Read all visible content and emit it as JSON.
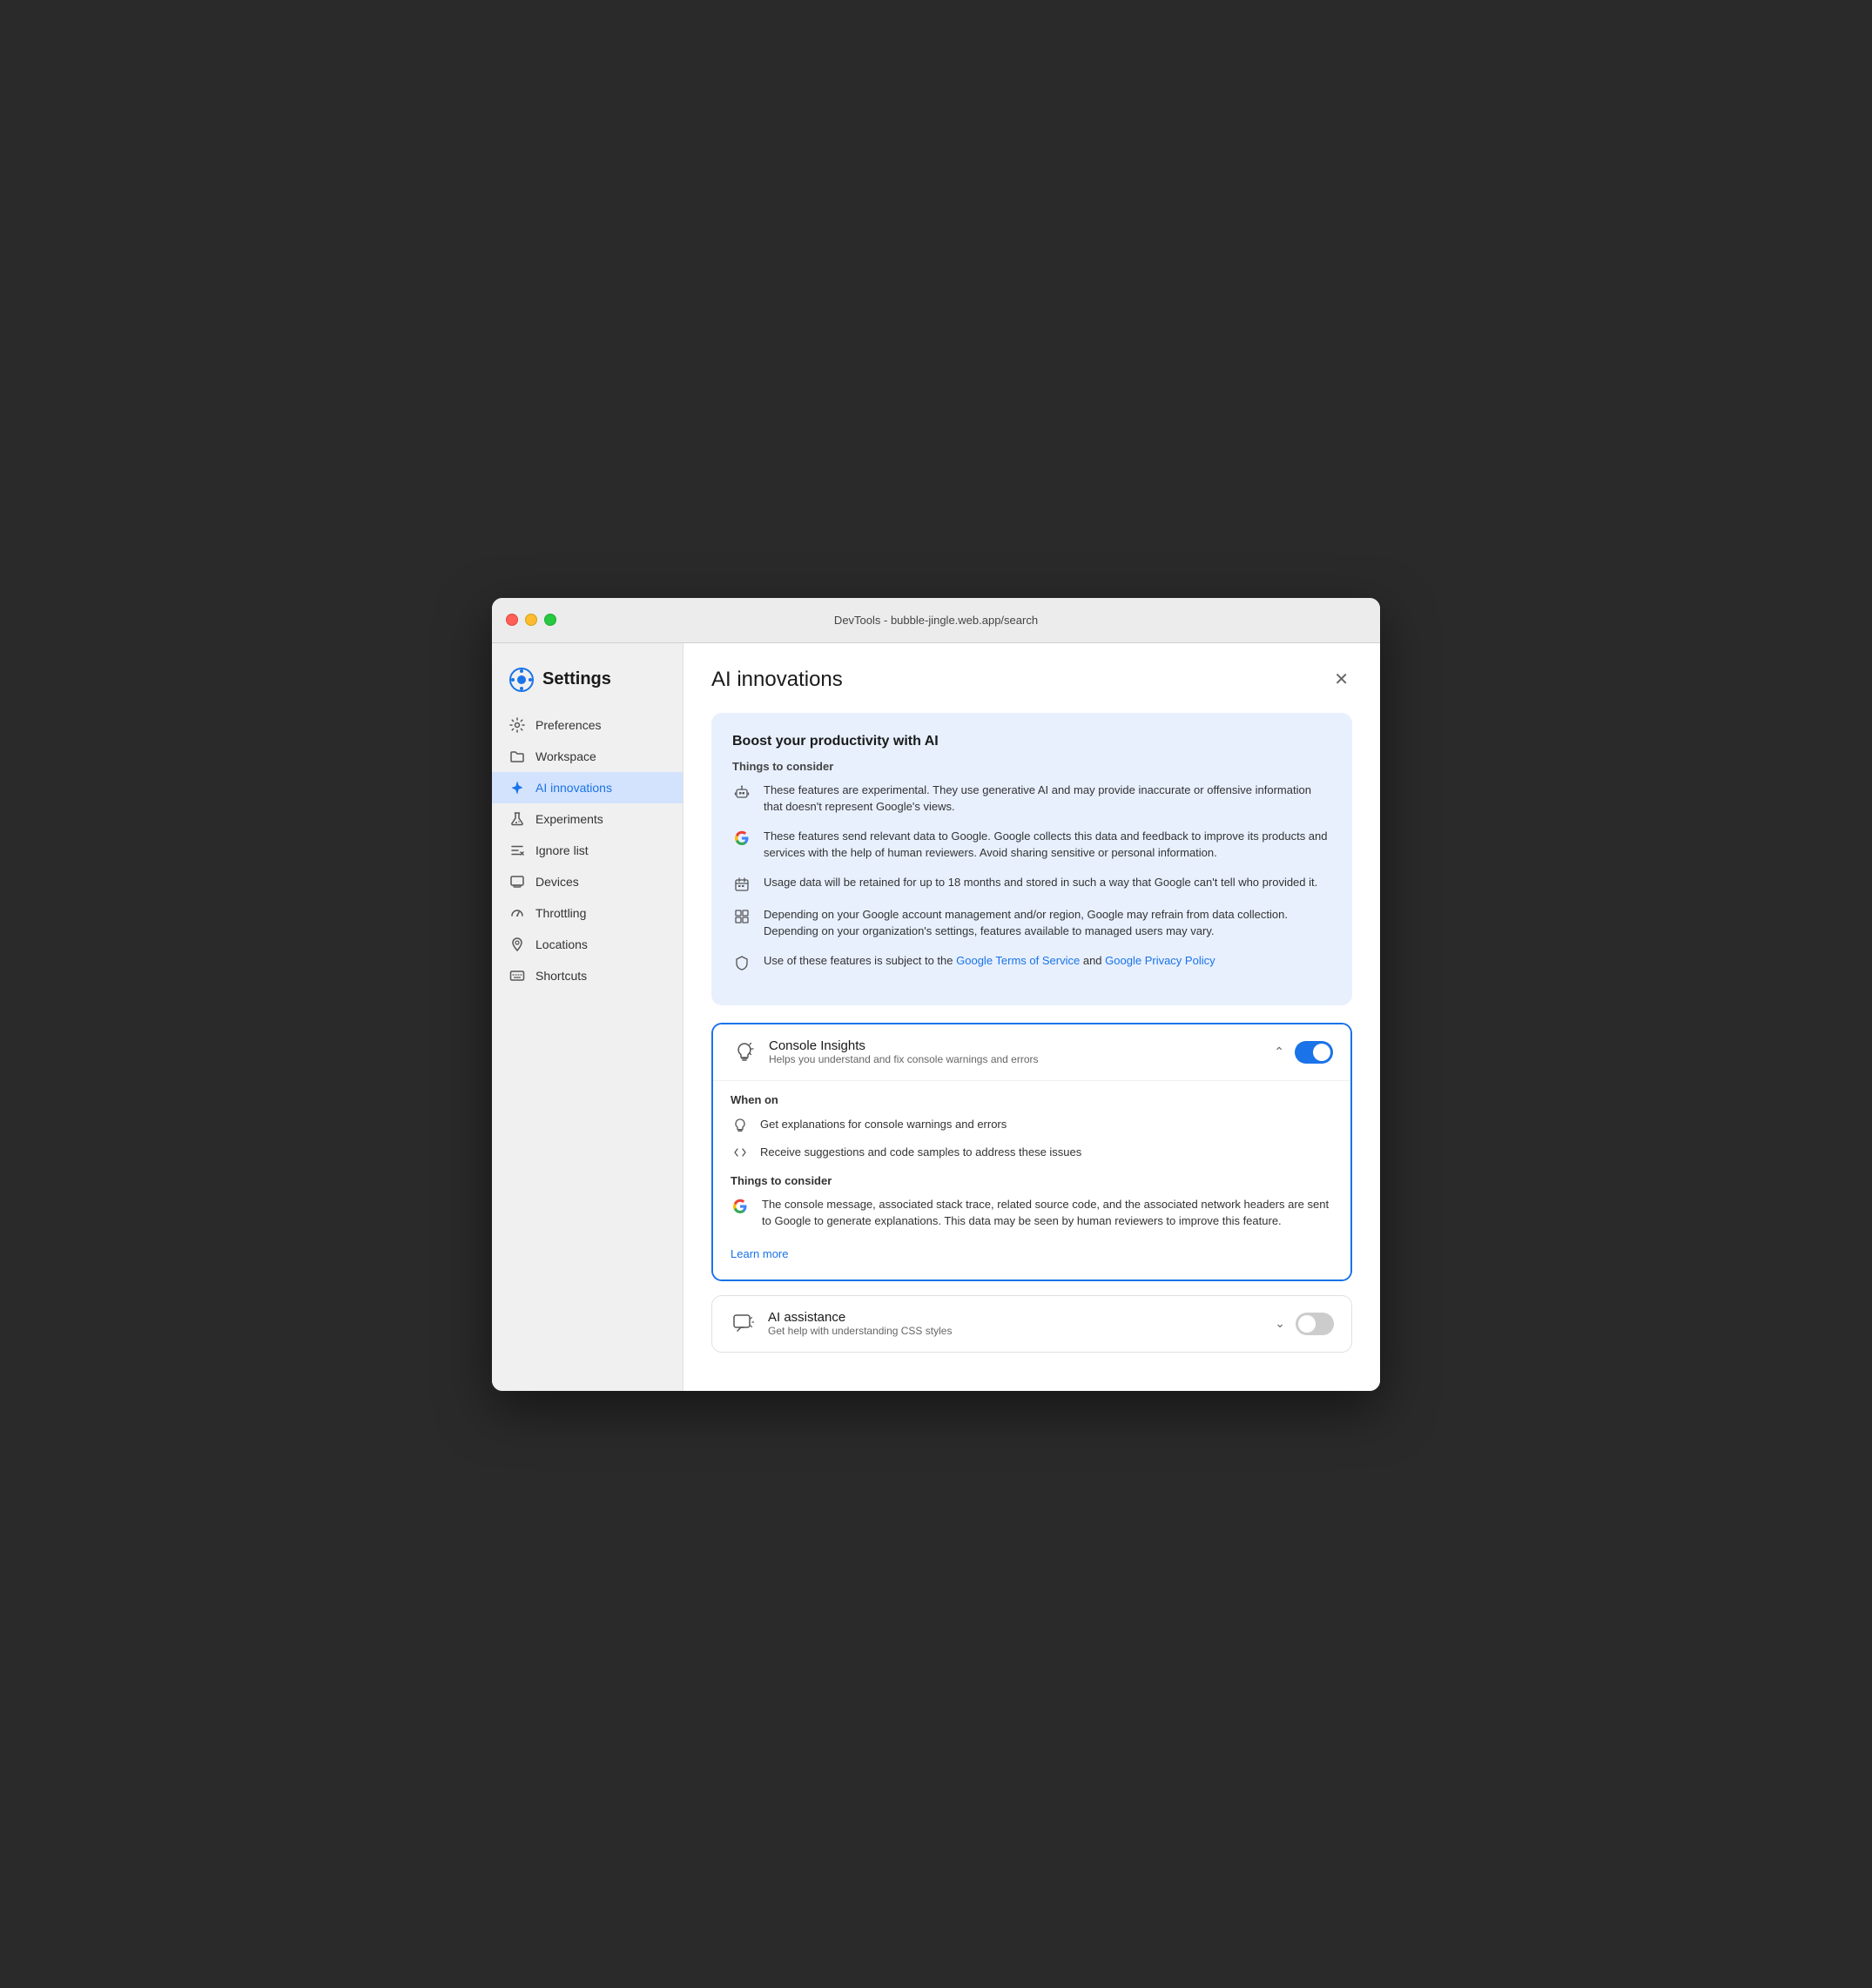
{
  "window": {
    "title": "DevTools - bubble-jingle.web.app/search"
  },
  "sidebar": {
    "header": {
      "title": "Settings"
    },
    "items": [
      {
        "id": "preferences",
        "label": "Preferences",
        "icon": "gear"
      },
      {
        "id": "workspace",
        "label": "Workspace",
        "icon": "folder"
      },
      {
        "id": "ai-innovations",
        "label": "AI innovations",
        "icon": "sparkle",
        "active": true
      },
      {
        "id": "experiments",
        "label": "Experiments",
        "icon": "flask"
      },
      {
        "id": "ignore-list",
        "label": "Ignore list",
        "icon": "list-x"
      },
      {
        "id": "devices",
        "label": "Devices",
        "icon": "device"
      },
      {
        "id": "throttling",
        "label": "Throttling",
        "icon": "gauge"
      },
      {
        "id": "locations",
        "label": "Locations",
        "icon": "pin"
      },
      {
        "id": "shortcuts",
        "label": "Shortcuts",
        "icon": "keyboard"
      }
    ]
  },
  "main": {
    "title": "AI innovations",
    "info_card": {
      "title": "Boost your productivity with AI",
      "subtitle": "Things to consider",
      "items": [
        {
          "icon": "robot",
          "text": "These features are experimental. They use generative AI and may provide inaccurate or offensive information that doesn't represent Google's views."
        },
        {
          "icon": "google-g",
          "text": "These features send relevant data to Google. Google collects this data and feedback to improve its products and services with the help of human reviewers. Avoid sharing sensitive or personal information."
        },
        {
          "icon": "calendar",
          "text": "Usage data will be retained for up to 18 months and stored in such a way that Google can't tell who provided it."
        },
        {
          "icon": "grid",
          "text": "Depending on your Google account management and/or region, Google may refrain from data collection. Depending on your organization's settings, features available to managed users may vary."
        },
        {
          "icon": "shield",
          "text": "Use of these features is subject to the",
          "link1": "Google Terms of Service",
          "link1_url": "#",
          "text2": " and ",
          "link2": "Google Privacy Policy",
          "link2_url": "#"
        }
      ]
    },
    "features": [
      {
        "id": "console-insights",
        "name": "Console Insights",
        "desc": "Helps you understand and fix console warnings and errors",
        "icon": "lightbulb-spark",
        "enabled": true,
        "expanded": true,
        "when_on": {
          "title": "When on",
          "items": [
            {
              "icon": "lightbulb",
              "text": "Get explanations for console warnings and errors"
            },
            {
              "icon": "code",
              "text": "Receive suggestions and code samples to address these issues"
            }
          ]
        },
        "things_to_consider": {
          "title": "Things to consider",
          "items": [
            {
              "icon": "google-g",
              "text": "The console message, associated stack trace, related source code, and the associated network headers are sent to Google to generate explanations. This data may be seen by human reviewers to improve this feature."
            }
          ]
        },
        "learn_more": "Learn more",
        "learn_more_url": "#"
      },
      {
        "id": "ai-assistance",
        "name": "AI assistance",
        "desc": "Get help with understanding CSS styles",
        "icon": "chat-spark",
        "enabled": false,
        "expanded": false
      }
    ]
  }
}
